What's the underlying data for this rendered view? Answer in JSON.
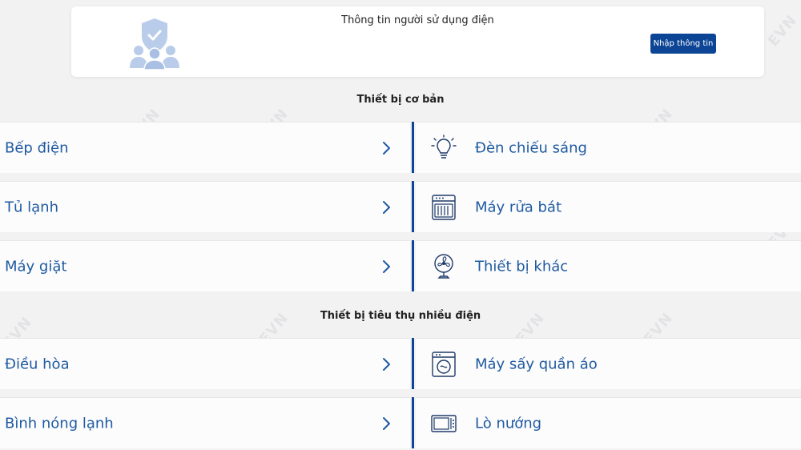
{
  "info_card": {
    "title": "Thông tin người sử dụng điện",
    "button_label": "Nhập thông tin"
  },
  "sections": {
    "basic_title": "Thiết bị cơ bản",
    "heavy_title": "Thiết bị tiêu thụ nhiều điện"
  },
  "basic_left": [
    "Bếp điện",
    "Tủ lạnh",
    "Máy giặt"
  ],
  "basic_right": [
    {
      "label": "Đèn chiếu sáng",
      "icon": "lightbulb-icon"
    },
    {
      "label": "Máy rửa bát",
      "icon": "dishwasher-icon"
    },
    {
      "label": "Thiết bị khác",
      "icon": "fan-icon"
    }
  ],
  "heavy_left": [
    "Điều hòa",
    "Bình nóng lạnh"
  ],
  "heavy_right": [
    {
      "label": "Máy sấy quần áo",
      "icon": "dryer-icon"
    },
    {
      "label": "Lò nướng",
      "icon": "oven-icon"
    }
  ],
  "watermark": "EVN",
  "colors": {
    "accent": "#0d4596",
    "label": "#1f5aa0",
    "background": "#f2f2f3"
  }
}
